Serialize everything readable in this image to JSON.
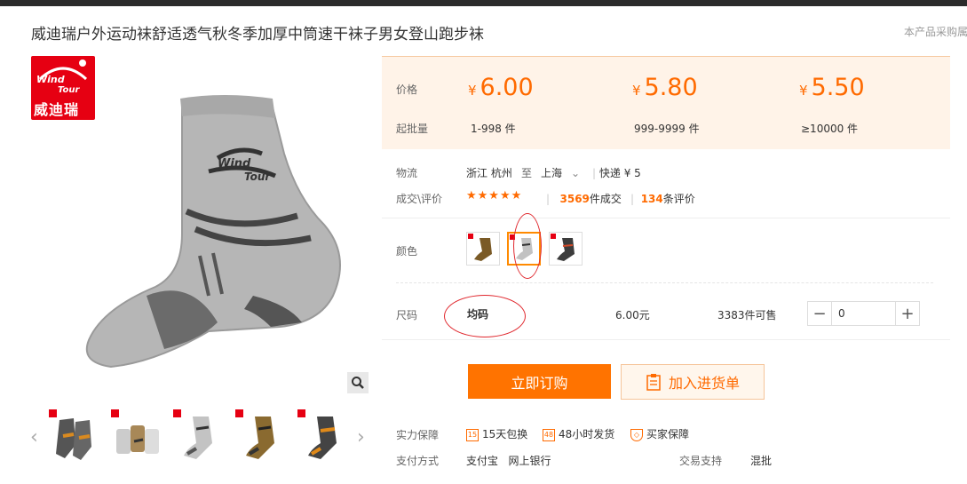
{
  "product": {
    "title": "威迪瑞户外运动袜舒适透气秋冬季加厚中筒速干袜子男女登山跑步袜",
    "top_right_text": "本产品采购属"
  },
  "brand": {
    "logo_text_1": "Wind",
    "logo_text_2": "Tour",
    "logo_cn": "威迪瑞"
  },
  "prices": {
    "price_label": "价格",
    "moq_label": "起批量",
    "currency": "¥",
    "tiers": [
      {
        "price": "6.00",
        "range": "1-998 件"
      },
      {
        "price": "5.80",
        "range": "999-9999 件"
      },
      {
        "price": "5.50",
        "range": "≥10000 件"
      }
    ]
  },
  "logistics": {
    "label": "物流",
    "from": "浙江 杭州",
    "to_word": "至",
    "to": "上海",
    "shipping": "快递 ¥ 5"
  },
  "reviews": {
    "label": "成交\\评价",
    "stars": "★★★★★",
    "rating": 4.5,
    "sold_count": "3569",
    "sold_suffix": "件成交",
    "review_count": "134",
    "review_suffix": "条评价"
  },
  "color": {
    "label": "颜色",
    "selected_index": 1
  },
  "size": {
    "label": "尺码",
    "value": "均码",
    "price": "6.00元",
    "stock": "3383",
    "stock_suffix": "件可售",
    "quantity": "0",
    "minus": "−",
    "plus": "+"
  },
  "actions": {
    "buy_now": "立即订购",
    "add_to_cart": "加入进货单"
  },
  "guarantee": {
    "label": "实力保障",
    "items": [
      {
        "icon": "15",
        "text": "15天包换"
      },
      {
        "icon": "48",
        "text": "48小时发货"
      },
      {
        "icon": "◇",
        "text": "买家保障"
      }
    ]
  },
  "payment": {
    "label": "支付方式",
    "methods": "支付宝   网上银行",
    "trade_label": "交易支持",
    "trade_value": "混批"
  },
  "colors": {
    "accent": "#ff6a00",
    "price_bg": "#fff3e8",
    "annotation": "#e0282e"
  }
}
